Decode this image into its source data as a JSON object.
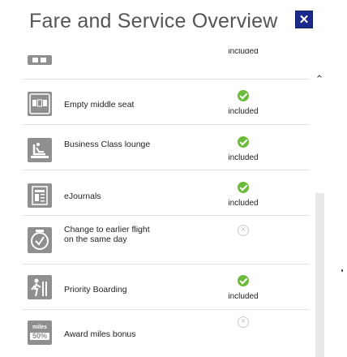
{
  "dialog": {
    "title": "Fare and Service Overview",
    "close_symbol": "✕"
  },
  "colors": {
    "accent": "#1b2a8a",
    "included": "#6cbb3c",
    "icon_bg": "#8f8f8f",
    "not_included": "#c4c4c4"
  },
  "scroll": {
    "up_symbol": "⌃"
  },
  "services": [
    {
      "label": "",
      "icon": "seat-icon",
      "status": "included",
      "status_text": "included"
    },
    {
      "label": "Empty middle seat",
      "icon": "empty-middle-seat-icon",
      "status": "included",
      "status_text": "included"
    },
    {
      "label": "Business Class lounge",
      "icon": "lounge-icon",
      "status": "included",
      "status_text": "included"
    },
    {
      "label": "eJournals",
      "icon": "ejournals-icon",
      "status": "included",
      "status_text": "included"
    },
    {
      "label": "Change to earlier flight on the same day",
      "icon": "clock-change-icon",
      "status": "not-included",
      "status_text": ""
    },
    {
      "label": "Priority Boarding",
      "icon": "priority-boarding-icon",
      "status": "included",
      "status_text": "included"
    },
    {
      "label": "Award miles bonus",
      "icon": "miles-bonus-icon",
      "status": "not-included",
      "status_text": "",
      "icon_text": [
        "miles",
        "50%"
      ]
    }
  ]
}
